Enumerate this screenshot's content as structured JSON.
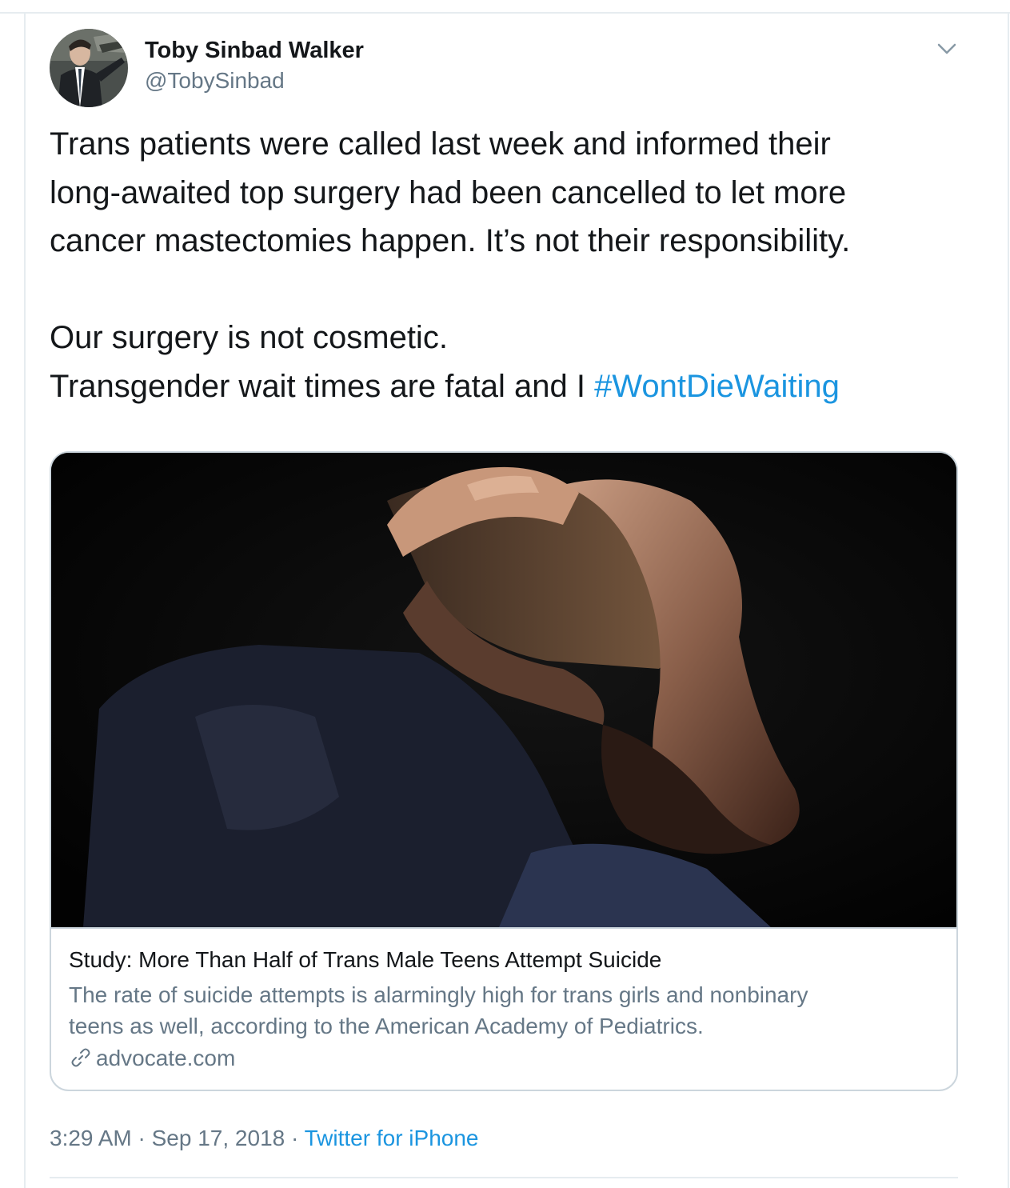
{
  "author": {
    "display_name": "Toby Sinbad Walker",
    "handle": "@TobySinbad",
    "avatar_icon": "profile-photo"
  },
  "menu": {
    "icon": "chevron-down-icon"
  },
  "tweet": {
    "lines": [
      "Trans patients were called last week and informed their",
      "long-awaited top surgery had been cancelled to let more",
      "cancer mastectomies happen. It’s not their responsibility.",
      "",
      "Our surgery is not cosmetic."
    ],
    "last_line_text": "Transgender wait times are fatal and I ",
    "hashtag": "#WontDieWaiting"
  },
  "link_card": {
    "title": "Study: More Than Half of Trans Male Teens Attempt Suicide",
    "description_lines": [
      "The rate of suicide attempts is alarmingly high for trans girls and nonbinary",
      "teens as well, according to the American Academy of Pediatrics."
    ],
    "domain": "advocate.com",
    "link_icon": "link-icon"
  },
  "meta": {
    "time": "3:29 AM",
    "separator": " · ",
    "date": "Sep 17, 2018",
    "source": "Twitter for iPhone"
  },
  "colors": {
    "text": "#14171a",
    "secondary": "#657786",
    "link": "#1b95e0",
    "border": "#ccd6dd"
  }
}
